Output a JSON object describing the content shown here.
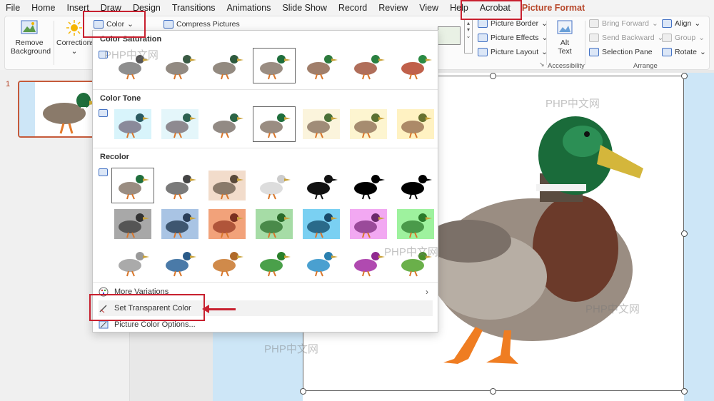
{
  "menubar": {
    "items": [
      "File",
      "Home",
      "Insert",
      "Draw",
      "Design",
      "Transitions",
      "Animations",
      "Slide Show",
      "Record",
      "Review",
      "View",
      "Help",
      "Acrobat",
      "Picture Format"
    ]
  },
  "ribbon": {
    "remove_background_1": "Remove",
    "remove_background_2": "Background",
    "corrections": "Corrections",
    "color": "Color",
    "compress_pictures": "Compress Pictures",
    "picture_border": "Picture Border",
    "picture_effects": "Picture Effects",
    "picture_layout": "Picture Layout",
    "alt_text_1": "Alt",
    "alt_text_2": "Text",
    "accessibility_label": "Accessibility",
    "bring_forward": "Bring Forward",
    "send_backward": "Send Backward",
    "selection_pane": "Selection Pane",
    "align": "Align",
    "group": "Group",
    "rotate": "Rotate",
    "arrange_label": "Arrange"
  },
  "thumbs": {
    "slide_number": "1"
  },
  "panel": {
    "color_saturation": "Color Saturation",
    "color_tone": "Color Tone",
    "recolor": "Recolor",
    "more_variations": "More Variations",
    "set_transparent_color": "Set Transparent Color",
    "picture_color_options": "Picture Color Options..."
  },
  "watermarks": [
    "PHP中文网",
    "PHP中文网",
    "PHP中文网",
    "PHP中文网",
    "PHP中文网"
  ],
  "colors": {
    "accent": "#b7472a",
    "annotation_red": "#c8202f",
    "slide_band": "#cde6f7"
  }
}
